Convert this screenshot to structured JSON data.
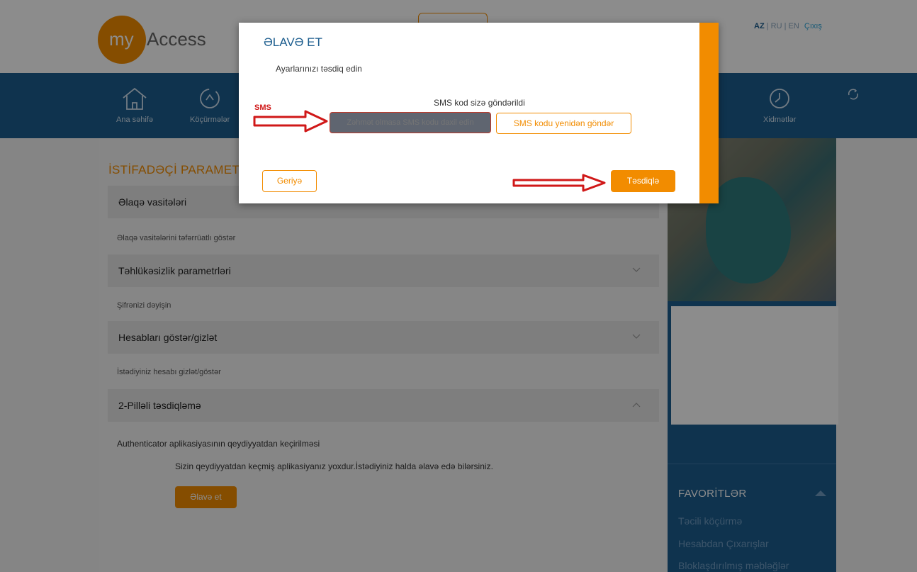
{
  "brand": {
    "logo_my": "my",
    "logo_access": "Access"
  },
  "languages": {
    "az": "AZ",
    "ru": "RU",
    "en": "EN",
    "separator": "|",
    "exit": "Çıxış"
  },
  "nav": [
    {
      "label": "Ana səhifə",
      "icon": "home-icon"
    },
    {
      "label": "Köçürmələr",
      "icon": "transfer-icon"
    },
    {
      "label": "Xidmətlər",
      "icon": "clock-icon"
    }
  ],
  "settings": {
    "title": "İSTİFADƏÇİ PARAMETRLƏRİ",
    "sections": [
      {
        "label": "Əlaqə vasitələri",
        "sub": "Əlaqə vasitələrini təfərrüatlı göstər"
      },
      {
        "label": "Təhlükəsizlik parametrləri",
        "sub": "Şifrənizi dəyişin"
      },
      {
        "label": "Hesabları göstər/gizlət",
        "sub": "İstədiyiniz hesabı gizlət/göstər"
      },
      {
        "label": "2-Pilləli təsdiqləmə",
        "sub": "Authenticator aplikasiyasının qeydiyyatdan keçirilməsi"
      }
    ],
    "twofa_message": "Sizin qeydiyyatdan keçmiş aplikasiyanız yoxdur.İstədiyiniz halda əlavə edə bilərsiniz.",
    "add_button": "Əlavə et"
  },
  "favorites": {
    "title": "FAVORİTLƏR",
    "items": [
      "Təcili köçürmə",
      "Hesabdan Çıxarışlar",
      "Bloklaşdırılmış məbləğlər"
    ]
  },
  "modal": {
    "title": "ƏLAVƏ ET",
    "subtitle": "Ayarlarınızı təsdiq edin",
    "sms_sent": "SMS kod sizə göndərildi",
    "sms_placeholder": "Zəhmət olmasa SMS kodu daxil edin",
    "resend_button": "SMS kodu yenidən göndər",
    "back_button": "Geriyə",
    "confirm_button": "Təsdiqlə",
    "annotation_label": "SMS"
  },
  "colors": {
    "brand_orange": "#f28c00",
    "brand_blue": "#1c5d8e",
    "annotation_red": "#d01818"
  }
}
